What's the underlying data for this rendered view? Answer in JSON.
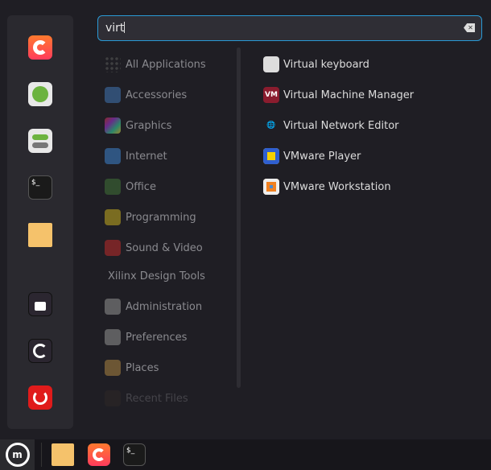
{
  "search": {
    "value": "virt",
    "clear_icon": "clear-text-icon"
  },
  "sidebar": [
    {
      "name": "firefox",
      "icon": "firefox-icon"
    },
    {
      "name": "software-manager",
      "icon": "software-manager-icon"
    },
    {
      "name": "system-settings",
      "icon": "toggle-settings-icon"
    },
    {
      "name": "terminal",
      "icon": "terminal-icon"
    },
    {
      "name": "files",
      "icon": "folder-icon"
    },
    {
      "name": "lock-screen",
      "icon": "lock-icon"
    },
    {
      "name": "logout",
      "icon": "logout-icon"
    },
    {
      "name": "shutdown",
      "icon": "power-icon"
    }
  ],
  "categories": [
    "All Applications",
    "Accessories",
    "Graphics",
    "Internet",
    "Office",
    "Programming",
    "Sound & Video",
    "Xilinx Design Tools",
    "Administration",
    "Preferences",
    "Places",
    "Recent Files"
  ],
  "results": [
    "Virtual keyboard",
    "Virtual Machine Manager",
    "Virtual Network Editor",
    "VMware Player",
    "VMware Workstation"
  ],
  "taskbar": {
    "items": [
      "menu",
      "files",
      "firefox",
      "terminal"
    ],
    "terminal_prompt": "$_"
  },
  "colors": {
    "accent": "#2a9ad6",
    "background": "#1f1e24"
  }
}
